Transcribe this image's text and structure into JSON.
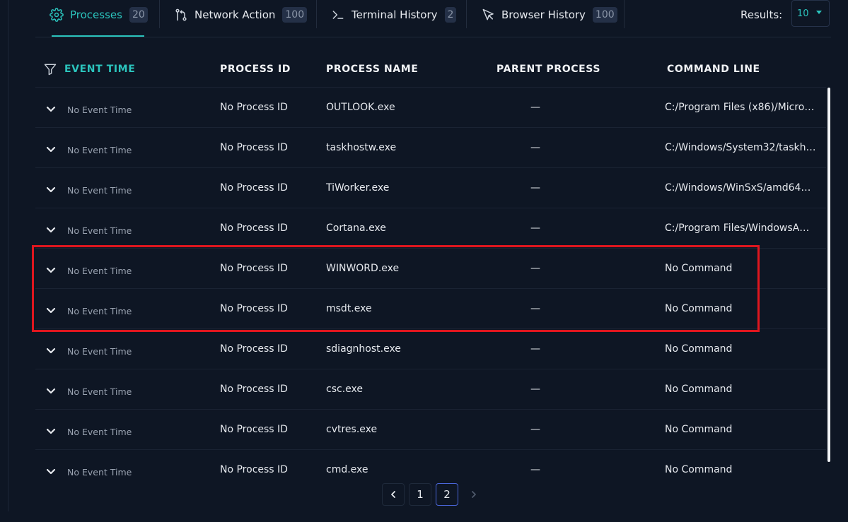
{
  "tabs": [
    {
      "label": "Processes",
      "count": "20",
      "icon": "gear-icon",
      "active": true
    },
    {
      "label": "Network Action",
      "count": "100",
      "icon": "git-branch-icon",
      "active": false
    },
    {
      "label": "Terminal History",
      "count": "2",
      "icon": "terminal-icon",
      "active": false
    },
    {
      "label": "Browser History",
      "count": "100",
      "icon": "cursor-icon",
      "active": false
    }
  ],
  "results": {
    "label": "Results:",
    "value": "10"
  },
  "table": {
    "columns": [
      "EVENT TIME",
      "PROCESS ID",
      "PROCESS NAME",
      "PARENT PROCESS",
      "COMMAND LINE"
    ],
    "rows": [
      {
        "time": "No Event Time",
        "pid": "No Process ID",
        "name": "OUTLOOK.exe",
        "parent": "—",
        "cmd": "C:/Program Files (x86)/Micro…"
      },
      {
        "time": "No Event Time",
        "pid": "No Process ID",
        "name": "taskhostw.exe",
        "parent": "—",
        "cmd": "C:/Windows/System32/taskh…"
      },
      {
        "time": "No Event Time",
        "pid": "No Process ID",
        "name": "TiWorker.exe",
        "parent": "—",
        "cmd": "C:/Windows/WinSxS/amd64…"
      },
      {
        "time": "No Event Time",
        "pid": "No Process ID",
        "name": "Cortana.exe",
        "parent": "—",
        "cmd": "C:/Program Files/WindowsA…"
      },
      {
        "time": "No Event Time",
        "pid": "No Process ID",
        "name": "WINWORD.exe",
        "parent": "—",
        "cmd": "No Command"
      },
      {
        "time": "No Event Time",
        "pid": "No Process ID",
        "name": "msdt.exe",
        "parent": "—",
        "cmd": "No Command"
      },
      {
        "time": "No Event Time",
        "pid": "No Process ID",
        "name": "sdiagnhost.exe",
        "parent": "—",
        "cmd": "No Command"
      },
      {
        "time": "No Event Time",
        "pid": "No Process ID",
        "name": "csc.exe",
        "parent": "—",
        "cmd": "No Command"
      },
      {
        "time": "No Event Time",
        "pid": "No Process ID",
        "name": "cvtres.exe",
        "parent": "—",
        "cmd": "No Command"
      },
      {
        "time": "No Event Time",
        "pid": "No Process ID",
        "name": "cmd.exe",
        "parent": "—",
        "cmd": "No Command"
      }
    ]
  },
  "pagination": {
    "pages": [
      "1",
      "2"
    ],
    "current": "2",
    "prev_icon": "chevron-left-icon",
    "next_icon": "chevron-right-icon"
  },
  "colors": {
    "accent": "#2bc4bd",
    "background": "#0e1624",
    "highlight": "#e0161e",
    "current_page_border": "#4a66d9"
  }
}
